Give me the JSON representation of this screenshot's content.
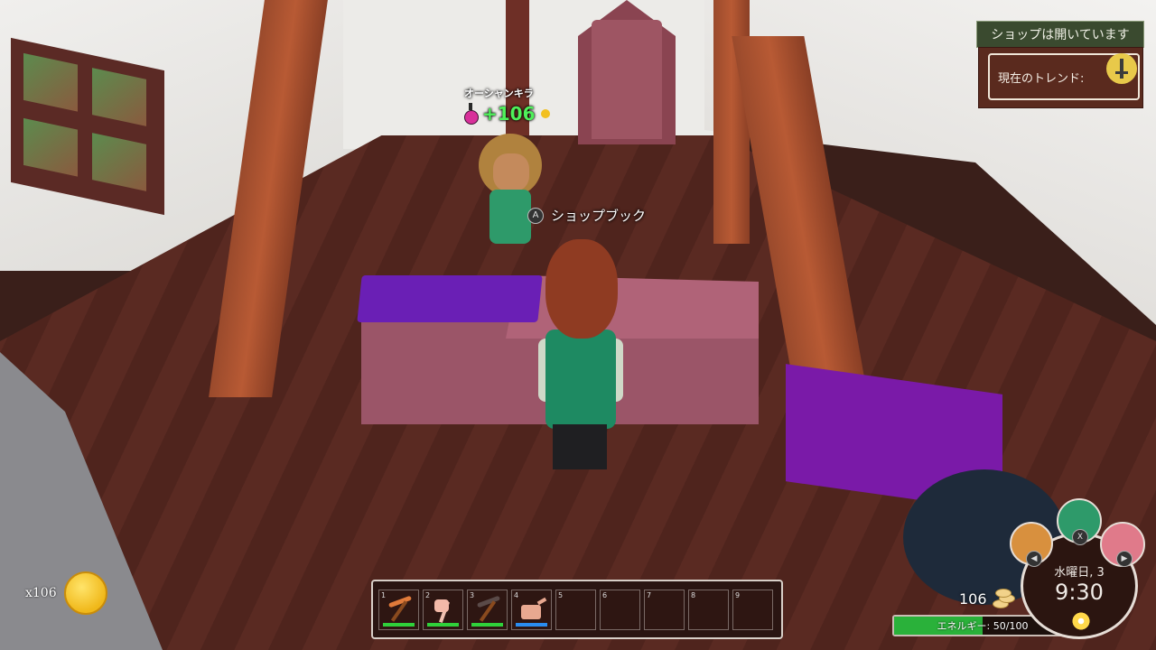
{
  "npc": {
    "name": "オーシャンキラ",
    "gain": "+106",
    "icon": "potion-icon"
  },
  "prompt": {
    "button": "A",
    "label": "ショップブック"
  },
  "shop": {
    "status": "ショップは開いています",
    "trend_label": "現在のトレンド:",
    "trend_icon": "sword-icon"
  },
  "inventory": {
    "coin_count": "x106"
  },
  "hotbar": {
    "slots": [
      {
        "num": "1",
        "item": "copper-pickaxe",
        "durability_color": "#2fd13a"
      },
      {
        "num": "2",
        "item": "copper-axe",
        "durability_color": "#2fd13a"
      },
      {
        "num": "3",
        "item": "pickaxe",
        "durability_color": "#2fd13a"
      },
      {
        "num": "4",
        "item": "watering-can",
        "durability_color": "#2a8df0"
      },
      {
        "num": "5"
      },
      {
        "num": "6"
      },
      {
        "num": "7"
      },
      {
        "num": "8"
      },
      {
        "num": "9"
      }
    ]
  },
  "status": {
    "gold": "106",
    "energy_label": "エネルギー: 50/100",
    "energy_value": 50,
    "energy_max": 100,
    "energy_color": "#2ab13a",
    "day": "水曜日, 3",
    "time": "9:30",
    "left_button": "◀",
    "mid_button": "X",
    "right_button": "▶"
  }
}
